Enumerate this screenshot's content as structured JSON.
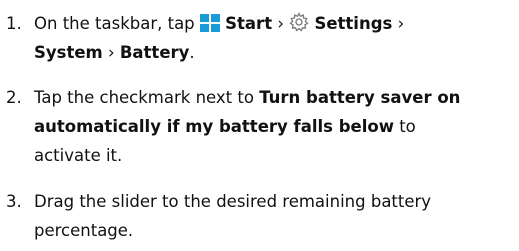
{
  "steps": [
    {
      "number": "1.",
      "line1": {
        "prefix": "On the taskbar, tap ",
        "start": "Start",
        "settings": "Settings",
        "arrow": " › "
      },
      "line2": {
        "system": "System",
        "arrow": " › ",
        "battery": "Battery",
        "period": "."
      },
      "icons": [
        "windows-start-icon",
        "gear-icon"
      ]
    },
    {
      "number": "2.",
      "line1": {
        "prefix": "Tap the checkmark next to ",
        "bold": "Turn battery saver on"
      },
      "line2": {
        "bold": "automatically if my battery falls below",
        "suffix": " to"
      },
      "line3": "activate it."
    },
    {
      "number": "3.",
      "line1": "Drag the slider to the desired remaining battery",
      "line2": "percentage."
    }
  ],
  "colors": {
    "text": "#111111",
    "windows_icon": "#1a9bd7",
    "gear_icon": "#777777"
  }
}
